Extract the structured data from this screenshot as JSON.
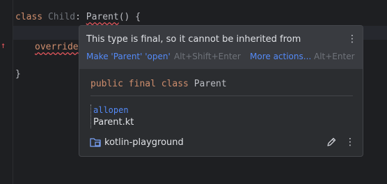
{
  "editor": {
    "line1": {
      "kw": "class",
      "name": "Child",
      "colon": ":",
      "parent": "Parent",
      "rest": "() {"
    },
    "line2": {
      "kw": "override"
    },
    "line3": {
      "brace": "}"
    }
  },
  "popup": {
    "message": "This type is final, so it cannot be inherited from",
    "actions": [
      {
        "label": "Make 'Parent' 'open'",
        "shortcut": "Alt+Shift+Enter"
      },
      {
        "label": "More actions...",
        "shortcut": "Alt+Enter"
      }
    ],
    "signature": {
      "modifiers": "public final class",
      "name": "Parent"
    },
    "module": {
      "lib": "allopen",
      "file": "Parent.kt"
    },
    "project": "kotlin-playground",
    "kebab": "⋮"
  },
  "colors": {
    "keyword": "#cf8e6d",
    "link": "#548af7",
    "error": "#e0555b",
    "background": "#1e1f22",
    "popup": "#2b2d30"
  },
  "icons": [
    "error-arrow-icon",
    "folder-module-icon",
    "pencil-icon",
    "kebab-icon"
  ]
}
